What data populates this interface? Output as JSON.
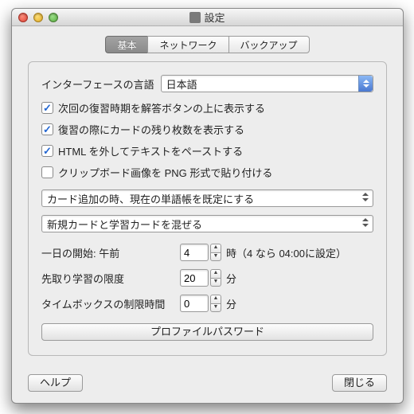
{
  "window": {
    "title": "設定"
  },
  "tabs": {
    "basic": "基本",
    "network": "ネットワーク",
    "backup": "バックアップ"
  },
  "language": {
    "label": "インターフェースの言語",
    "value": "日本語"
  },
  "checks": {
    "c1": {
      "checked": true,
      "label": "次回の復習時期を解答ボタンの上に表示する"
    },
    "c2": {
      "checked": true,
      "label": "復習の際にカードの残り枚数を表示する"
    },
    "c3": {
      "checked": true,
      "label": "HTML を外してテキストをペーストする"
    },
    "c4": {
      "checked": false,
      "label": "クリップボード画像を PNG 形式で貼り付ける"
    }
  },
  "dropdown1": "カード追加の時、現在の単語帳を既定にする",
  "dropdown2": "新規カードと学習カードを混ぜる",
  "dayStart": {
    "label": "一日の開始: 午前",
    "value": "4",
    "suffix": "時（4 なら 04:00に設定）"
  },
  "learnAhead": {
    "label": "先取り学習の限度",
    "value": "20",
    "suffix": "分"
  },
  "timebox": {
    "label": "タイムボックスの制限時間",
    "value": "0",
    "suffix": "分"
  },
  "profileBtn": "プロファイルパスワード",
  "help": "ヘルプ",
  "close": "閉じる"
}
